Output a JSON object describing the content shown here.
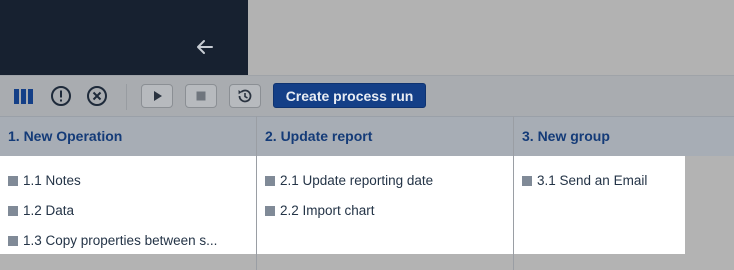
{
  "toolbar": {
    "icons": [
      "columns-icon",
      "info-circle-icon",
      "close-circle-icon",
      "play-icon",
      "stop-icon",
      "history-icon"
    ],
    "create_label": "Create process run"
  },
  "columns": [
    {
      "title": "1. New Operation",
      "items": [
        "1.1 Notes",
        "1.2 Data",
        "1.3 Copy properties between s..."
      ]
    },
    {
      "title": "2. Update report",
      "items": [
        "2.1 Update reporting date",
        "2.2 Import chart"
      ]
    },
    {
      "title": "3. New group",
      "items": [
        "3.1 Send an Email"
      ]
    }
  ],
  "colors": {
    "sidebar": "#172130",
    "accent": "#143f87",
    "title": "#143b78",
    "bullet": "#808a97"
  }
}
